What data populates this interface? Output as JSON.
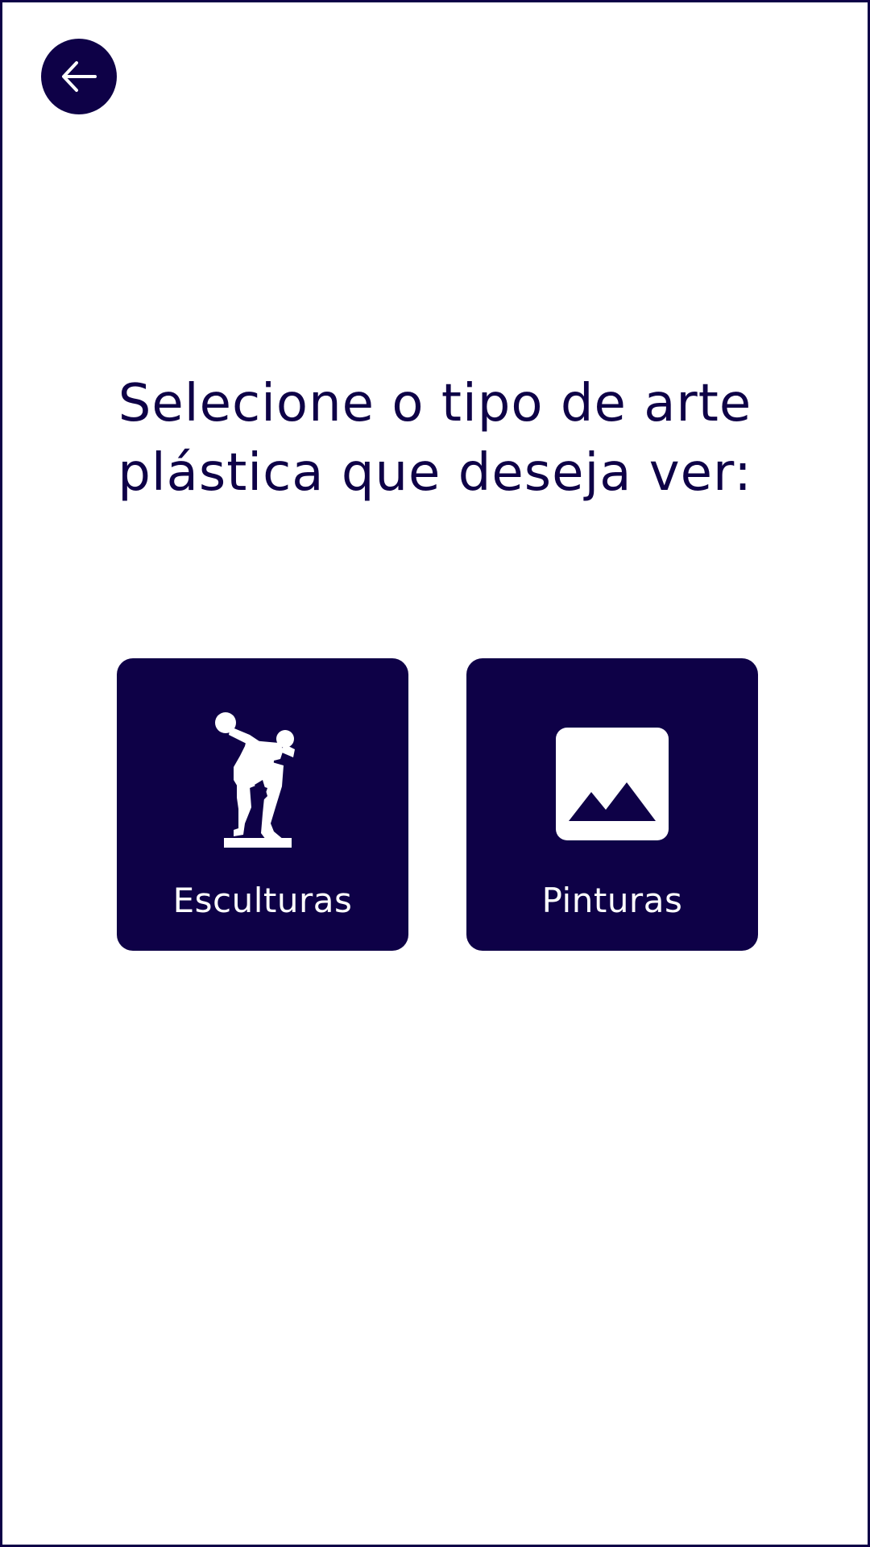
{
  "colors": {
    "primary": "#0e0147",
    "background": "#ffffff",
    "on_primary": "#ffffff"
  },
  "header": {
    "back_button": {
      "icon": "arrow-left-icon"
    }
  },
  "main": {
    "title_lines": [
      "Selecione o tipo de arte",
      "plástica que deseja ver:"
    ],
    "options": [
      {
        "label": "Esculturas",
        "icon": "sculpture-icon"
      },
      {
        "label": "Pinturas",
        "icon": "image-icon"
      }
    ]
  }
}
